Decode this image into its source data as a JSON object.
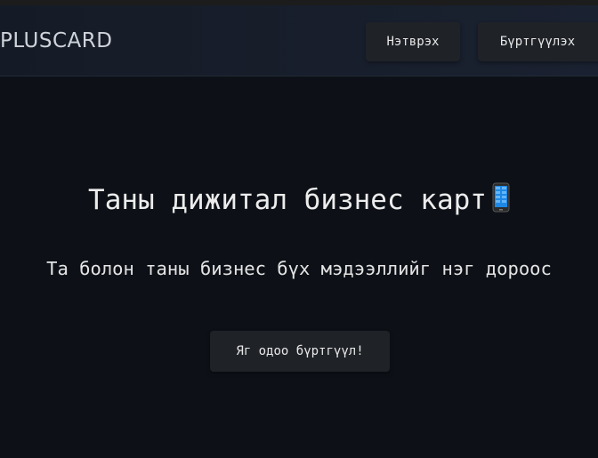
{
  "header": {
    "logo": "PLUSCARD",
    "login_label": "Нэтврэх",
    "register_label": "Бүртгүүлэх"
  },
  "hero": {
    "title": "Таны дижитал бизнес карт",
    "title_icon": "mobile-phone-icon",
    "subtitle": "Та болон таны бизнес бүх мэдээллийг нэг дороос",
    "cta_label": "Яг одоо бүртгүүл!"
  },
  "colors": {
    "background": "#0d1117",
    "header": "#151b26",
    "button": "#1f2227",
    "text": "#e6e6e6"
  }
}
